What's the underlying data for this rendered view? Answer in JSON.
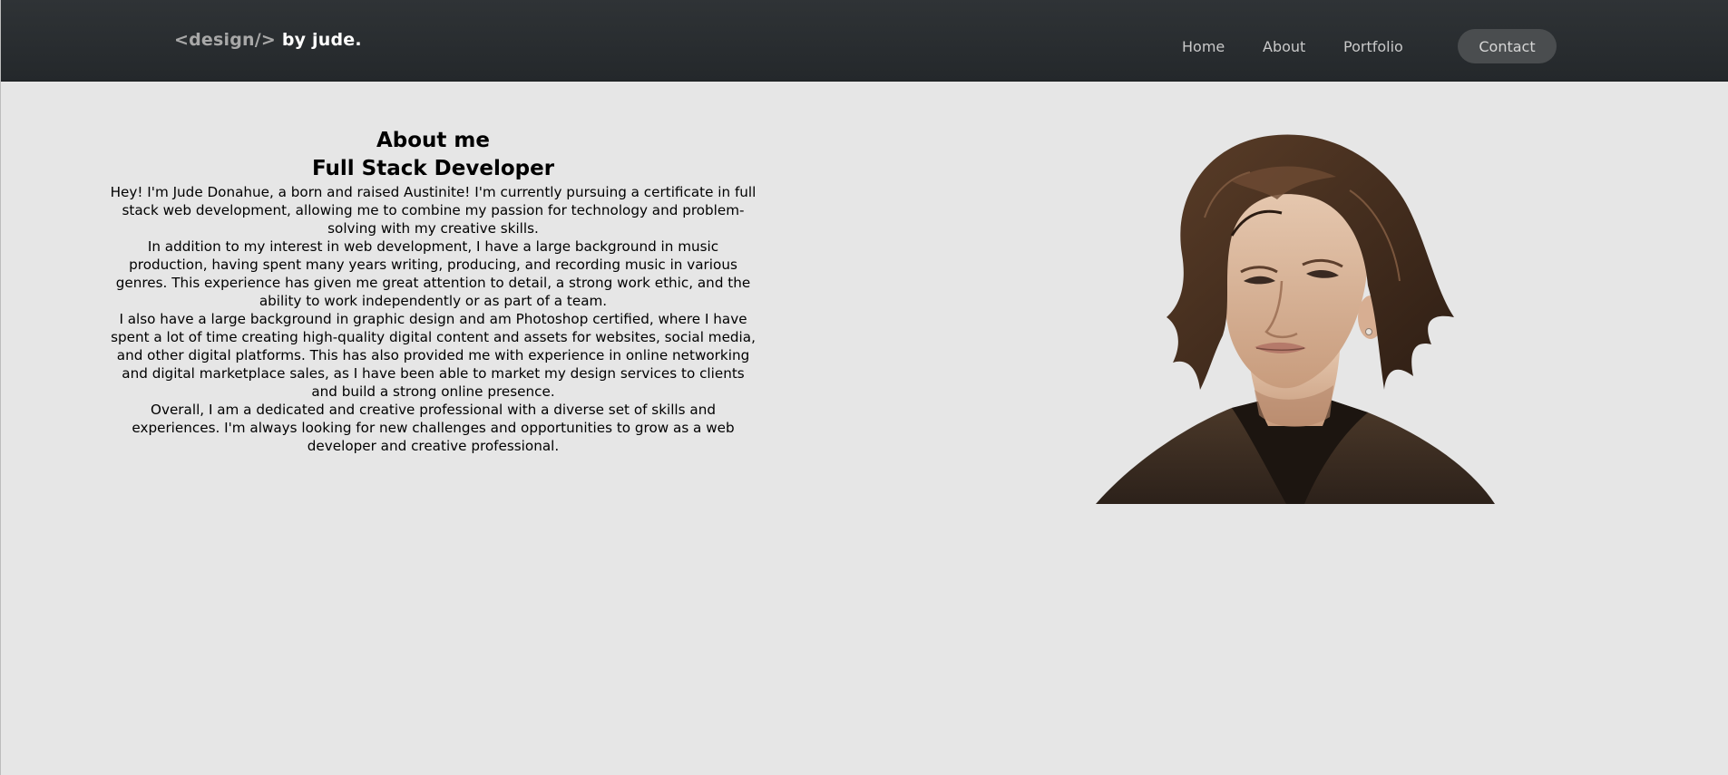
{
  "header": {
    "logo_tag": "<design/>",
    "logo_by": " by jude.",
    "nav": [
      "Home",
      "About",
      "Portfolio"
    ],
    "contact_label": "Contact"
  },
  "about": {
    "title": "About me",
    "subtitle": "Full Stack Developer",
    "paragraphs": [
      "Hey! I'm Jude Donahue, a born and raised Austinite! I'm currently pursuing a certificate in full stack web development, allowing me to combine my passion for technology and problem-solving with my creative skills.",
      "In addition to my interest in web development, I have a large background in music production, having spent many years writing, producing, and recording music in various genres. This experience has given me great attention to detail, a strong work ethic, and the ability to work independently or as part of a team.",
      "I also have a large background in graphic design and am Photoshop certified, where I have spent a lot of time creating high-quality digital content and assets for websites, social media, and other digital platforms. This has also provided me with experience in online networking and digital marketplace sales, as I have been able to market my design services to clients and build a strong online presence.",
      "Overall, I am a dedicated and creative professional with a diverse set of skills and experiences. I'm always looking for new challenges and opportunities to grow as a web developer and creative professional."
    ]
  },
  "colors": {
    "page_bg": "#e6e6e6",
    "header_bg": "#2b2f32",
    "contact_bg": "#4a4d4f"
  }
}
